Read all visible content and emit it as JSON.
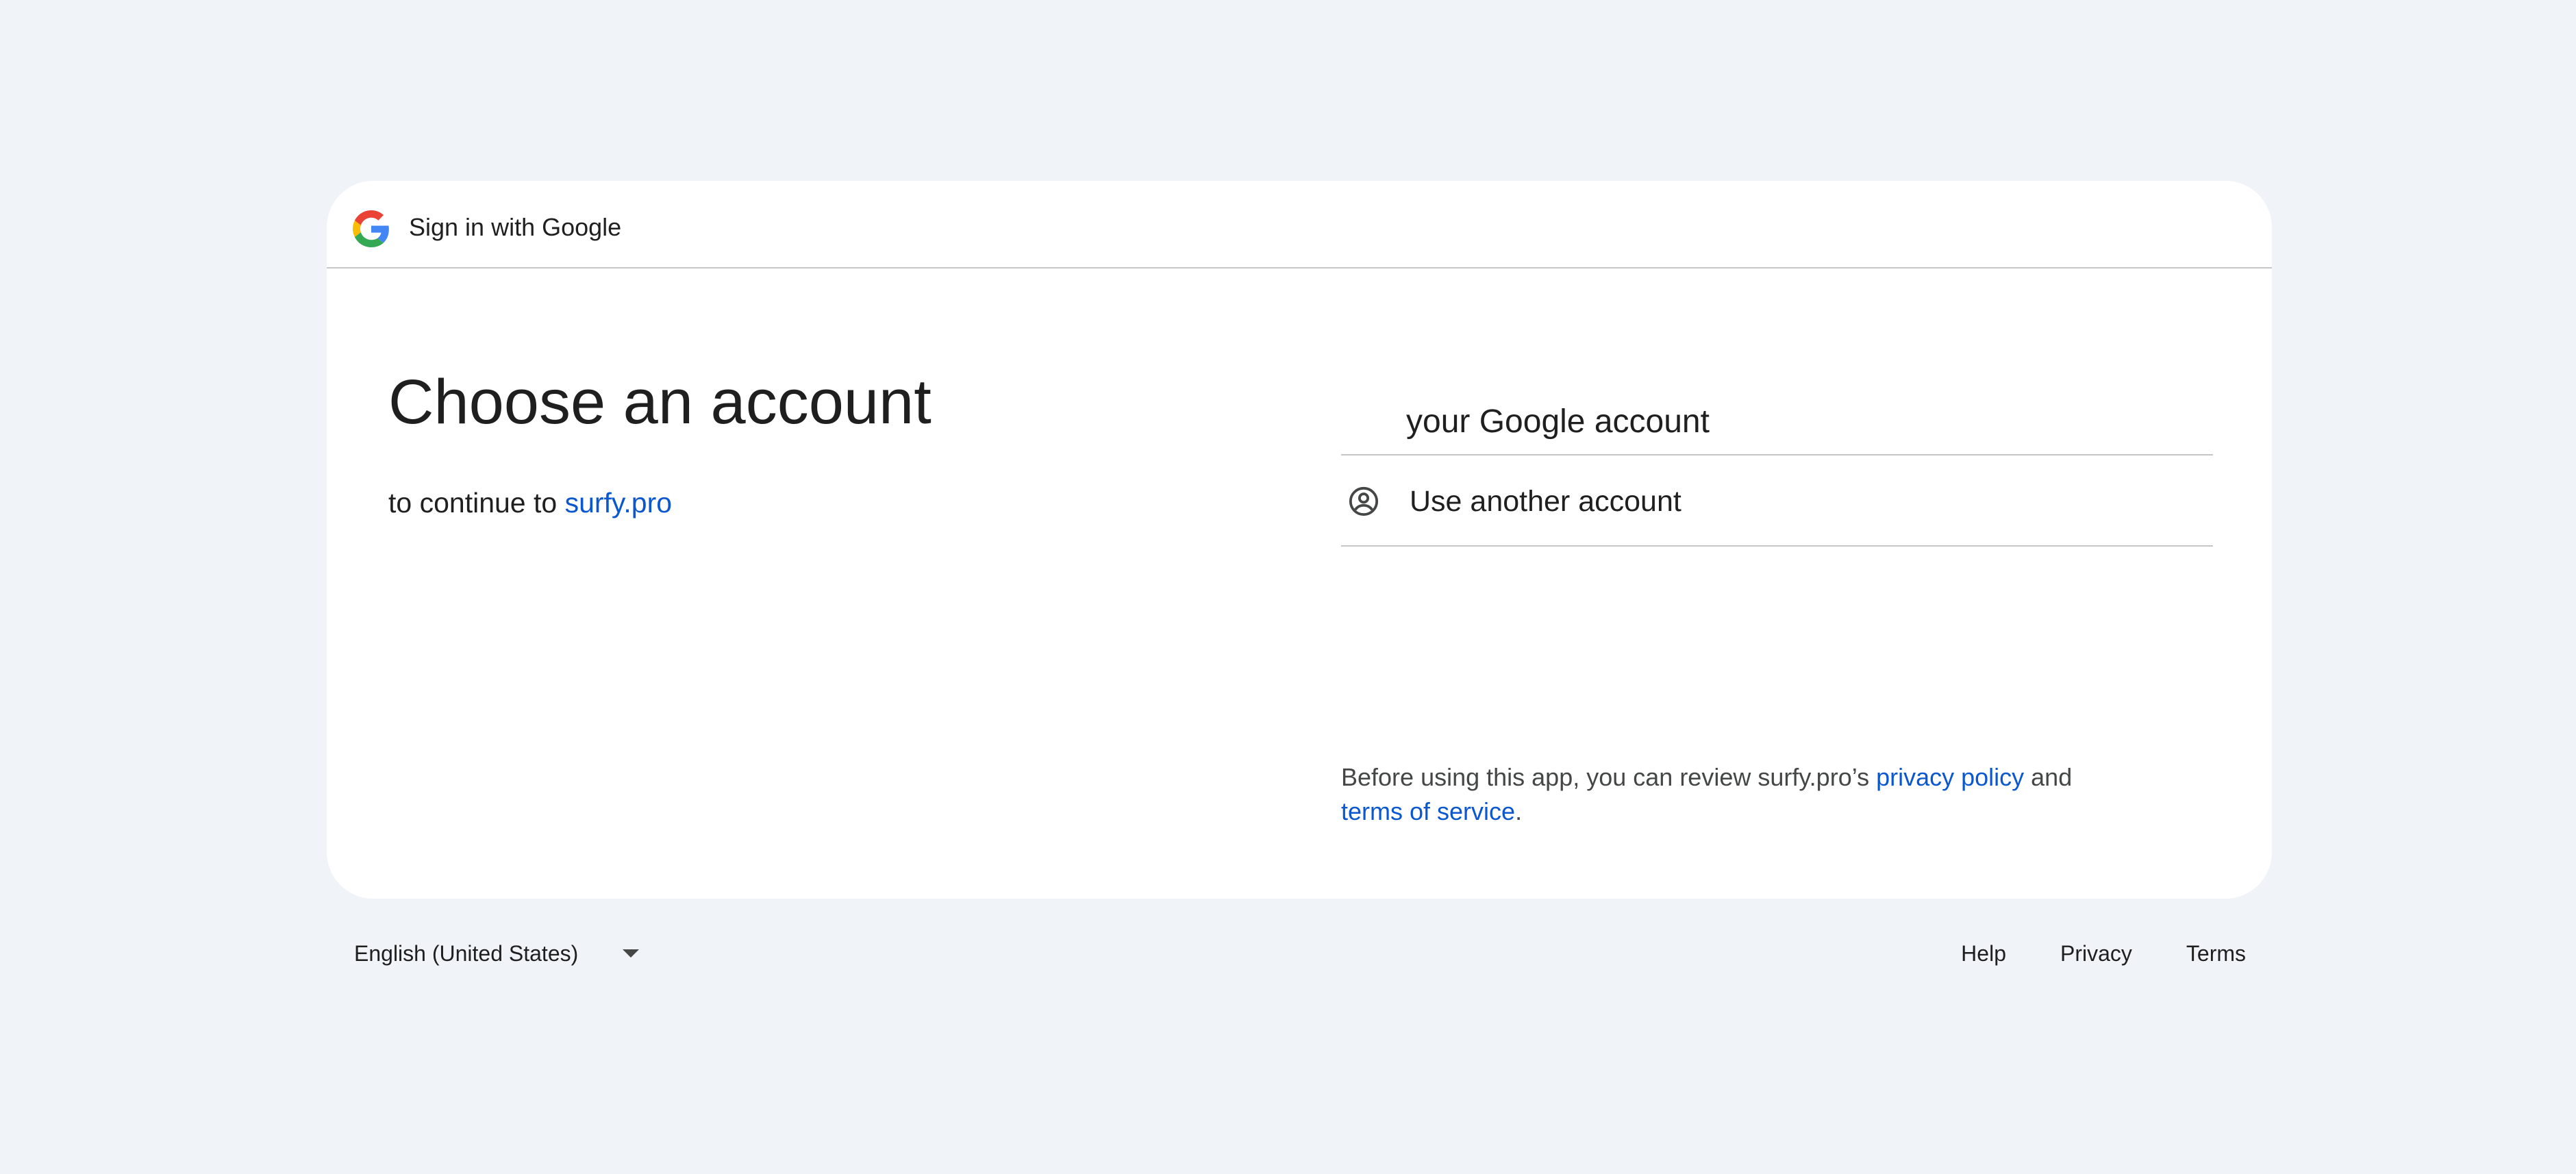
{
  "header": {
    "title": "Sign in with Google",
    "logo_icon": "google-g-icon"
  },
  "main": {
    "title": "Choose an account",
    "subtitle_prefix": "to continue to ",
    "app_link": "surfy.pro"
  },
  "accounts": {
    "current_account_label": "your Google account",
    "use_another_label": "Use another account",
    "use_another_icon": "account-circle-icon"
  },
  "policy": {
    "text_before": "Before using this app, you can review surfy.pro’s ",
    "privacy_link": "privacy policy",
    "text_middle": " and ",
    "terms_link": "terms of service",
    "text_after": "."
  },
  "footer": {
    "language": "English (United States)",
    "links": [
      "Help",
      "Privacy",
      "Terms"
    ]
  },
  "colors": {
    "background": "#f0f4f9",
    "card": "#ffffff",
    "link": "#0b57d0",
    "divider": "#c4c7c5",
    "text": "#1f1f1f"
  }
}
